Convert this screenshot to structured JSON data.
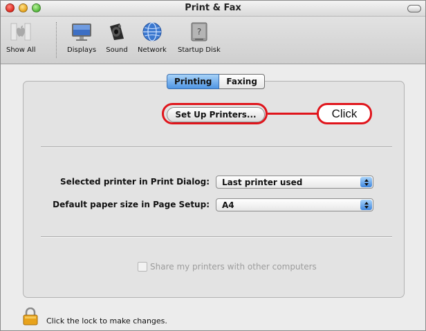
{
  "window": {
    "title": "Print & Fax"
  },
  "toolbar": {
    "items": [
      {
        "label": "Show All",
        "icon": "apple-logo-icon"
      },
      {
        "label": "Displays",
        "icon": "display-monitor-icon"
      },
      {
        "label": "Sound",
        "icon": "speaker-icon"
      },
      {
        "label": "Network",
        "icon": "network-globe-icon"
      },
      {
        "label": "Startup Disk",
        "icon": "hard-disk-icon"
      }
    ]
  },
  "tabs": [
    {
      "label": "Printing",
      "selected": true
    },
    {
      "label": "Faxing",
      "selected": false
    }
  ],
  "printing": {
    "setup_button": "Set Up Printers...",
    "selected_printer_label": "Selected printer in Print Dialog:",
    "selected_printer_value": "Last printer used",
    "paper_size_label": "Default paper size in Page Setup:",
    "paper_size_value": "A4",
    "share_label": "Share my printers with other computers",
    "share_checked": false,
    "share_enabled": false
  },
  "annotation": {
    "callout_text": "Click",
    "color": "#e0141b"
  },
  "footer": {
    "lock_text": "Click the lock to make changes."
  }
}
